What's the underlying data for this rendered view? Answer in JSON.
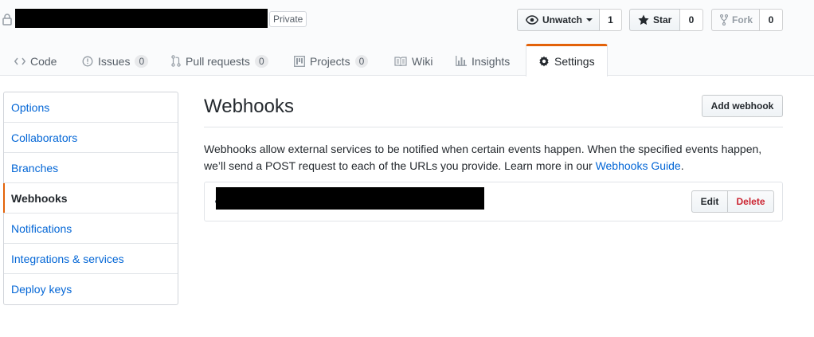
{
  "repo": {
    "visibility_label": "Private"
  },
  "actions": {
    "watch": {
      "label": "Unwatch",
      "count": "1"
    },
    "star": {
      "label": "Star",
      "count": "0"
    },
    "fork": {
      "label": "Fork",
      "count": "0"
    }
  },
  "tabs": [
    {
      "label": "Code",
      "icon": "code-icon"
    },
    {
      "label": "Issues",
      "icon": "issue-icon",
      "count": "0"
    },
    {
      "label": "Pull requests",
      "icon": "pull-request-icon",
      "count": "0"
    },
    {
      "label": "Projects",
      "icon": "project-icon",
      "count": "0"
    },
    {
      "label": "Wiki",
      "icon": "book-icon"
    },
    {
      "label": "Insights",
      "icon": "graph-icon"
    },
    {
      "label": "Settings",
      "icon": "gear-icon",
      "selected": true
    }
  ],
  "sidebar": {
    "items": [
      {
        "label": "Options"
      },
      {
        "label": "Collaborators"
      },
      {
        "label": "Branches"
      },
      {
        "label": "Webhooks",
        "selected": true
      },
      {
        "label": "Notifications"
      },
      {
        "label": "Integrations & services"
      },
      {
        "label": "Deploy keys"
      }
    ]
  },
  "main": {
    "title": "Webhooks",
    "add_button": "Add webhook",
    "description_text": "Webhooks allow external services to be notified when certain events happen. When the specified events happen, we’ll send a POST request to each of the URLs you provide. Learn more in our ",
    "guide_link": "Webhooks Guide",
    "description_end": ".",
    "hook": {
      "edit_label": "Edit",
      "delete_label": "Delete"
    }
  },
  "colors": {
    "accent": "#e36209",
    "link": "#0366d6",
    "danger": "#cb2431"
  }
}
